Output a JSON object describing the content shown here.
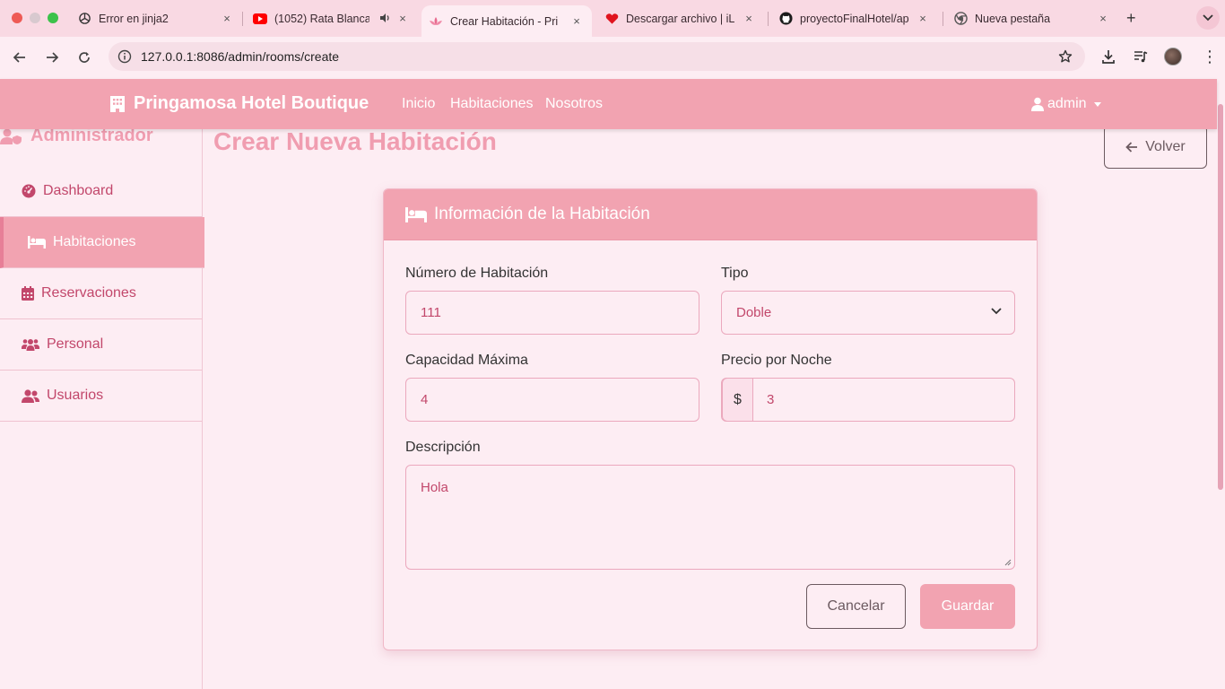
{
  "browser": {
    "tabs": [
      {
        "title": "Error en jinja2",
        "icon": "openai-icon"
      },
      {
        "title": "(1052) Rata Blanca",
        "icon": "youtube-icon"
      },
      {
        "title": "Crear Habitación - Pri",
        "icon": "lotus-icon"
      },
      {
        "title": "Descargar archivo | iL",
        "icon": "heart-icon"
      },
      {
        "title": "proyectoFinalHotel/ap",
        "icon": "github-icon"
      },
      {
        "title": "Nueva pestaña",
        "icon": "chrome-icon"
      }
    ],
    "url": "127.0.0.1:8086/admin/rooms/create",
    "close_glyph": "×",
    "new_tab_glyph": "+",
    "menu_glyph": "⋮",
    "colors": {
      "tab_strip": "#f9d9e3",
      "youtube": "#ff0000",
      "heart": "#e0141e"
    }
  },
  "navbar": {
    "brand": "Pringamosa Hotel Boutique",
    "links": [
      "Inicio",
      "Habitaciones",
      "Nosotros"
    ],
    "user": "admin"
  },
  "sidebar": {
    "title": "Administrador",
    "items": [
      {
        "label": "Dashboard",
        "icon": "gauge-icon",
        "active": false
      },
      {
        "label": "Habitaciones",
        "icon": "bed-icon",
        "active": true
      },
      {
        "label": "Reservaciones",
        "icon": "calendar-icon",
        "active": false
      },
      {
        "label": "Personal",
        "icon": "users-icon",
        "active": false
      },
      {
        "label": "Usuarios",
        "icon": "user-group-icon",
        "active": false
      }
    ]
  },
  "main": {
    "title": "Crear Nueva Habitación",
    "back_label": "Volver",
    "card_title": "Información de la Habitación",
    "fields": {
      "room_number": {
        "label": "Número de Habitación",
        "value": "111"
      },
      "type": {
        "label": "Tipo",
        "value": "Doble"
      },
      "capacity": {
        "label": "Capacidad Máxima",
        "value": "4"
      },
      "price": {
        "label": "Precio por Noche",
        "currency": "$",
        "value": "3"
      },
      "description": {
        "label": "Descripción",
        "value": "Hola"
      }
    },
    "cancel_label": "Cancelar",
    "save_label": "Guardar"
  },
  "theme": {
    "primary": "#f2a3b1",
    "accent_text": "#c2476b",
    "background": "#fdedf3",
    "title": "#f09db0"
  }
}
